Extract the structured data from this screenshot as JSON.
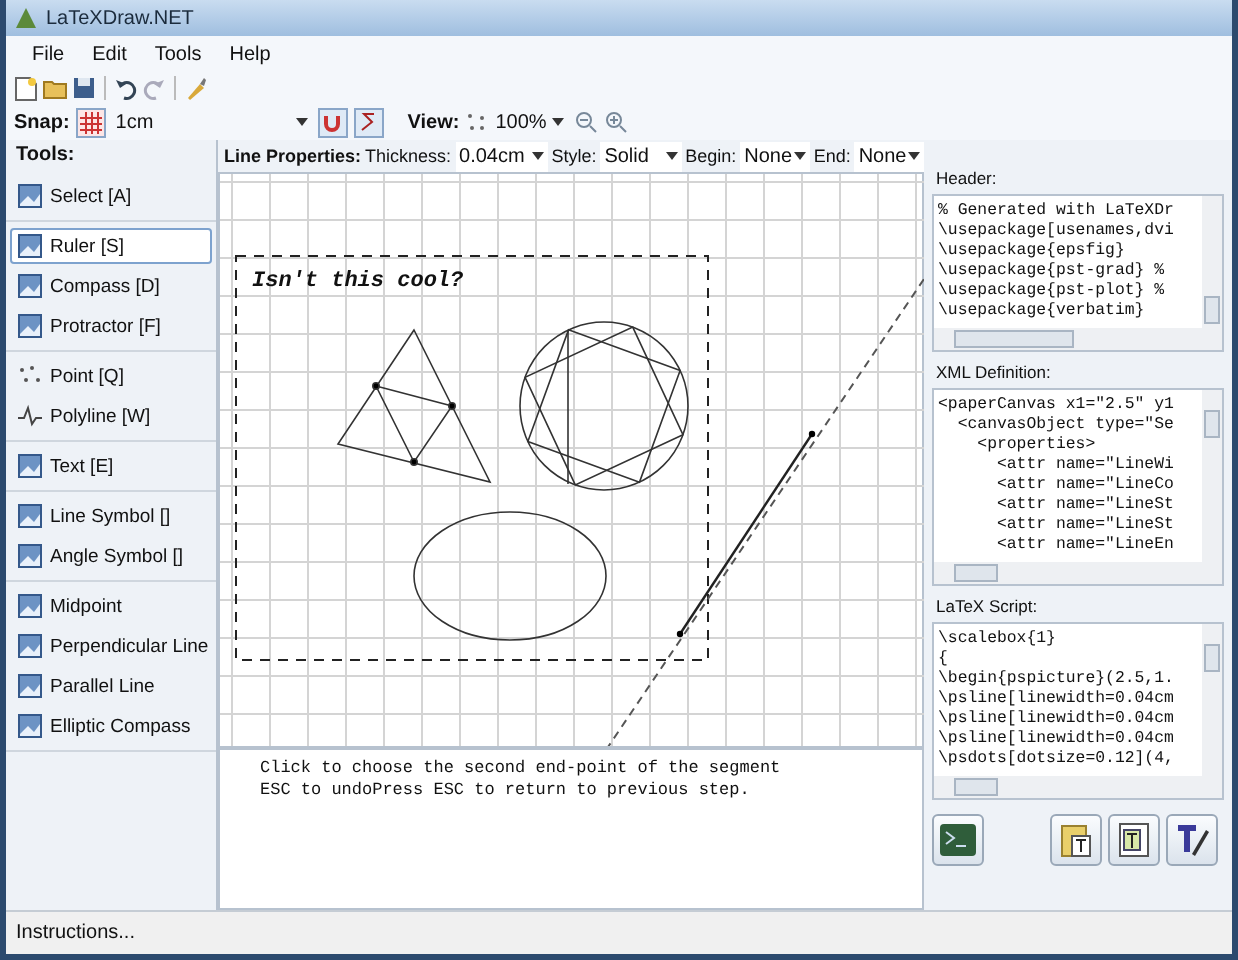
{
  "window": {
    "title": "LaTeXDraw.NET"
  },
  "menu": [
    "File",
    "Edit",
    "Tools",
    "Help"
  ],
  "snap": {
    "label": "Snap:",
    "value": "1cm"
  },
  "view": {
    "label": "View:",
    "value": "100%"
  },
  "tools_label": "Tools:",
  "tool_groups": [
    {
      "items": [
        {
          "label": "Select [A]",
          "selected": false
        }
      ]
    },
    {
      "items": [
        {
          "label": "Ruler [S]",
          "selected": true
        },
        {
          "label": "Compass [D]",
          "selected": false
        },
        {
          "label": "Protractor [F]",
          "selected": false
        }
      ]
    },
    {
      "items": [
        {
          "label": "Point [Q]",
          "selected": false
        },
        {
          "label": "Polyline [W]",
          "selected": false
        }
      ]
    },
    {
      "items": [
        {
          "label": "Text [E]",
          "selected": false
        }
      ]
    },
    {
      "items": [
        {
          "label": "Line Symbol []",
          "selected": false
        },
        {
          "label": "Angle Symbol []",
          "selected": false
        }
      ]
    },
    {
      "items": [
        {
          "label": "Midpoint",
          "selected": false
        },
        {
          "label": "Perpendicular Line",
          "selected": false
        },
        {
          "label": "Parallel Line",
          "selected": false
        },
        {
          "label": "Elliptic Compass",
          "selected": false
        }
      ]
    }
  ],
  "line_properties": {
    "label": "Line Properties:",
    "fields": [
      {
        "label": "Thickness:",
        "value": "0.04cm"
      },
      {
        "label": "Style:",
        "value": "Solid"
      },
      {
        "label": "Begin:",
        "value": "None"
      },
      {
        "label": "End:",
        "value": "None"
      }
    ]
  },
  "canvas": {
    "caption": "Isn't this cool?"
  },
  "messages": [
    "Click to choose the second end-point of the segment",
    "ESC to undoPress ESC to return to previous step."
  ],
  "panels": [
    {
      "title": "Header:",
      "lines": [
        "% Generated with LaTeXDr",
        "\\usepackage[usenames,dvi",
        "\\usepackage{epsfig}",
        "\\usepackage{pst-grad} %",
        "\\usepackage{pst-plot} %",
        "\\usepackage{verbatim}"
      ]
    },
    {
      "title": "XML Definition:",
      "lines": [
        "<paperCanvas x1=\"2.5\" y1",
        "  <canvasObject type=\"Se",
        "    <properties>",
        "      <attr name=\"LineWi",
        "      <attr name=\"LineCo",
        "      <attr name=\"LineSt",
        "      <attr name=\"LineSt",
        "      <attr name=\"LineEn"
      ]
    },
    {
      "title": "LaTeX Script:",
      "lines": [
        "\\scalebox{1}",
        "{",
        "\\begin{pspicture}(2.5,1.",
        "\\psline[linewidth=0.04cm",
        "\\psline[linewidth=0.04cm",
        "\\psline[linewidth=0.04cm",
        "\\psdots[dotsize=0.12](4,"
      ]
    }
  ],
  "status_bar": "Instructions..."
}
